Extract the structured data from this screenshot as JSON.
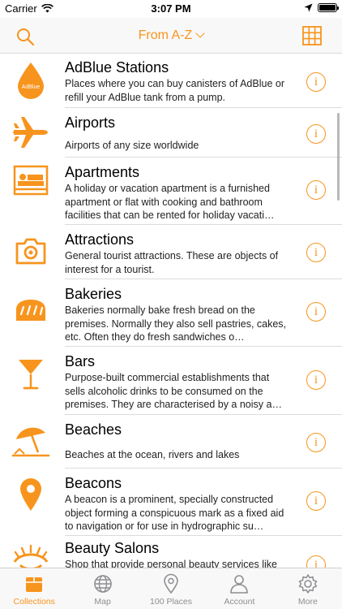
{
  "status": {
    "carrier": "Carrier",
    "time": "3:07 PM"
  },
  "nav": {
    "title": "From A-Z",
    "search_icon": "search-icon",
    "grid_icon": "grid-icon"
  },
  "colors": {
    "accent": "#f7941d",
    "tab_inactive": "#8e8e93"
  },
  "rows": [
    {
      "title": "AdBlue Stations",
      "icon": "adblue-drop-icon",
      "icon_text": "AdBlue",
      "desc": "Places where you can buy canisters of AdBlue or refill your AdBlue tank from a pump."
    },
    {
      "title": "Airports",
      "icon": "airplane-icon",
      "desc": "Airports of any size worldwide"
    },
    {
      "title": "Apartments",
      "icon": "bed-icon",
      "desc": "A holiday or vacation apartment is a furnished apartment or flat with cooking and bathroom facilities that can be rented for holiday vacati…"
    },
    {
      "title": "Attractions",
      "icon": "camera-icon",
      "desc": "General tourist attractions. These are objects of interest for a tourist."
    },
    {
      "title": "Bakeries",
      "icon": "bread-icon",
      "desc": "Bakeries normally bake fresh bread on the premises. Normally they also sell pastries, cakes, etc. Often they do fresh sandwiches o…"
    },
    {
      "title": "Bars",
      "icon": "cocktail-glass-icon",
      "desc": "Purpose-built commercial establishments that sells alcoholic drinks to be consumed on the premises. They are characterised by a noisy a…"
    },
    {
      "title": "Beaches",
      "icon": "beach-umbrella-icon",
      "desc": "Beaches at the ocean, rivers and lakes"
    },
    {
      "title": "Beacons",
      "icon": "map-pin-icon",
      "desc": "A beacon is a prominent, specially constructed object forming a conspicuous mark as a fixed aid to navigation or for use in hydrographic su…"
    },
    {
      "title": "Beauty Salons",
      "icon": "eye-lashes-icon",
      "desc": "Shop that provide personal beauty services like"
    }
  ],
  "tabs": [
    {
      "label": "Collections",
      "icon": "box-icon",
      "active": true
    },
    {
      "label": "Map",
      "icon": "globe-icon",
      "active": false
    },
    {
      "label": "100 Places",
      "icon": "map-pin-icon",
      "active": false
    },
    {
      "label": "Account",
      "icon": "person-icon",
      "active": false
    },
    {
      "label": "More",
      "icon": "gear-icon",
      "active": false
    }
  ]
}
